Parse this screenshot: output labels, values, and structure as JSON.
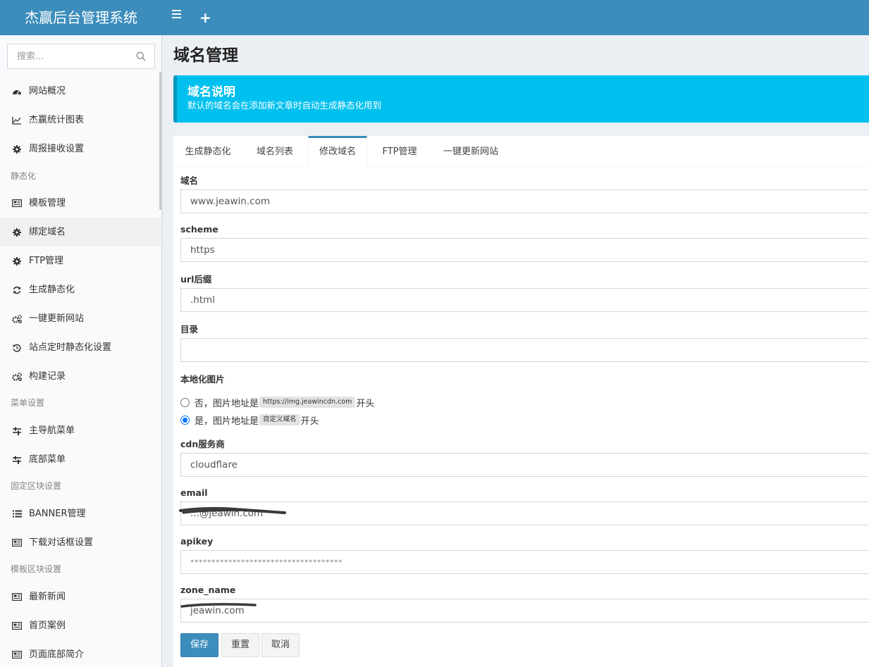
{
  "app": {
    "title": "杰赢后台管理系统"
  },
  "sidebar": {
    "search_placeholder": "搜索...",
    "items": [
      {
        "label": "网站概况",
        "icon": "dashboard-icon"
      },
      {
        "label": "杰赢统计图表",
        "icon": "line-chart-icon"
      },
      {
        "label": "周报接收设置",
        "icon": "gear-icon"
      },
      {
        "header": "静态化"
      },
      {
        "label": "模板管理",
        "icon": "newspaper-icon"
      },
      {
        "label": "绑定域名",
        "icon": "gear-icon",
        "active": true
      },
      {
        "label": "FTP管理",
        "icon": "gear-icon"
      },
      {
        "label": "生成静态化",
        "icon": "refresh-icon"
      },
      {
        "label": "一键更新网站",
        "icon": "gears-icon"
      },
      {
        "label": "站点定时静态化设置",
        "icon": "history-icon"
      },
      {
        "label": "构建记录",
        "icon": "gears-icon"
      },
      {
        "header": "菜单设置"
      },
      {
        "label": "主导航菜单",
        "icon": "sliders-icon"
      },
      {
        "label": "底部菜单",
        "icon": "sliders-icon"
      },
      {
        "header": "固定区块设置"
      },
      {
        "label": "BANNER管理",
        "icon": "list-icon"
      },
      {
        "label": "下载对话框设置",
        "icon": "newspaper-icon"
      },
      {
        "header": "模板区块设置"
      },
      {
        "label": "最新新闻",
        "icon": "newspaper-icon"
      },
      {
        "label": "首页案例",
        "icon": "newspaper-icon"
      },
      {
        "label": "页面底部简介",
        "icon": "newspaper-icon"
      }
    ]
  },
  "main": {
    "title": "域名管理",
    "callout": {
      "title": "域名说明",
      "text": "默认的域名会在添加新文章时自动生成静态化用到"
    },
    "tabs": [
      "生成静态化",
      "域名列表",
      "修改域名",
      "FTP管理",
      "一键更新网站"
    ],
    "active_tab": 2,
    "form": {
      "domain": {
        "label": "域名",
        "value": "www.jeawin.com"
      },
      "scheme": {
        "label": "scheme",
        "value": "https"
      },
      "url_suffix": {
        "label": "url后缀",
        "value": ".html"
      },
      "directory": {
        "label": "目录",
        "value": ""
      },
      "localize_images": {
        "label": "本地化图片",
        "option_no": {
          "prefix": "否，图片地址是",
          "code": "https://img.jeawincdn.com",
          "suffix": "开头"
        },
        "option_yes": {
          "prefix": "是，图片地址是",
          "code": "自定义域名",
          "suffix": "开头"
        },
        "selected": "yes"
      },
      "cdn": {
        "label": "cdn服务商",
        "value": "cloudflare"
      },
      "email": {
        "label": "email",
        "value": "...@jeawin.com"
      },
      "apikey": {
        "label": "apikey",
        "value": "************************************"
      },
      "zone_name": {
        "label": "zone_name",
        "value": "jeawin.com"
      }
    },
    "buttons": {
      "save": "保存",
      "reset": "重置",
      "cancel": "取消"
    }
  },
  "colors": {
    "primary": "#3c8dbc",
    "callout": "#00c0ef",
    "sidebar_bg": "#f9fafc",
    "content_bg": "#ecf0f5"
  }
}
